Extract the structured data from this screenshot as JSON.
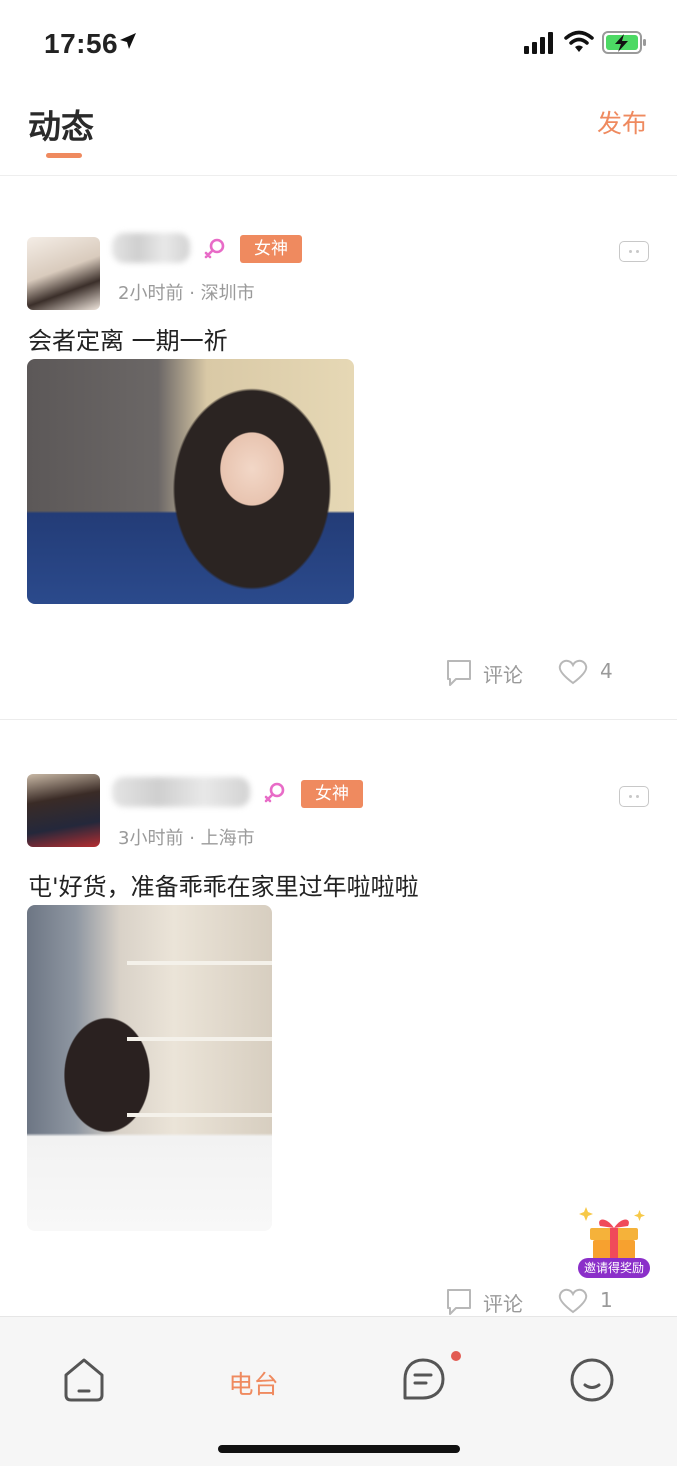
{
  "status_bar": {
    "time": "17:56"
  },
  "header": {
    "title": "动态",
    "publish_label": "发布"
  },
  "posts": [
    {
      "badge": "女神",
      "time": "2小时前",
      "location": "深圳市",
      "separator": "·",
      "text": "会者定离  一期一祈",
      "comment_label": "评论",
      "like_count": "4"
    },
    {
      "badge": "女神",
      "time": "3小时前",
      "location": "上海市",
      "separator": "·",
      "text": "屯'好货，准备乖乖在家里过年啦啦啦",
      "comment_label": "评论",
      "like_count": "1"
    }
  ],
  "gift": {
    "label": "邀请得奖励"
  },
  "tabbar": {
    "radio_label": "电台"
  },
  "colors": {
    "accent": "#ef8a5f",
    "badge": "#ef8a5f",
    "female_icon": "#e86bc7",
    "notification_dot": "#e25b52",
    "gift_label_bg": "#8b2fc9"
  }
}
